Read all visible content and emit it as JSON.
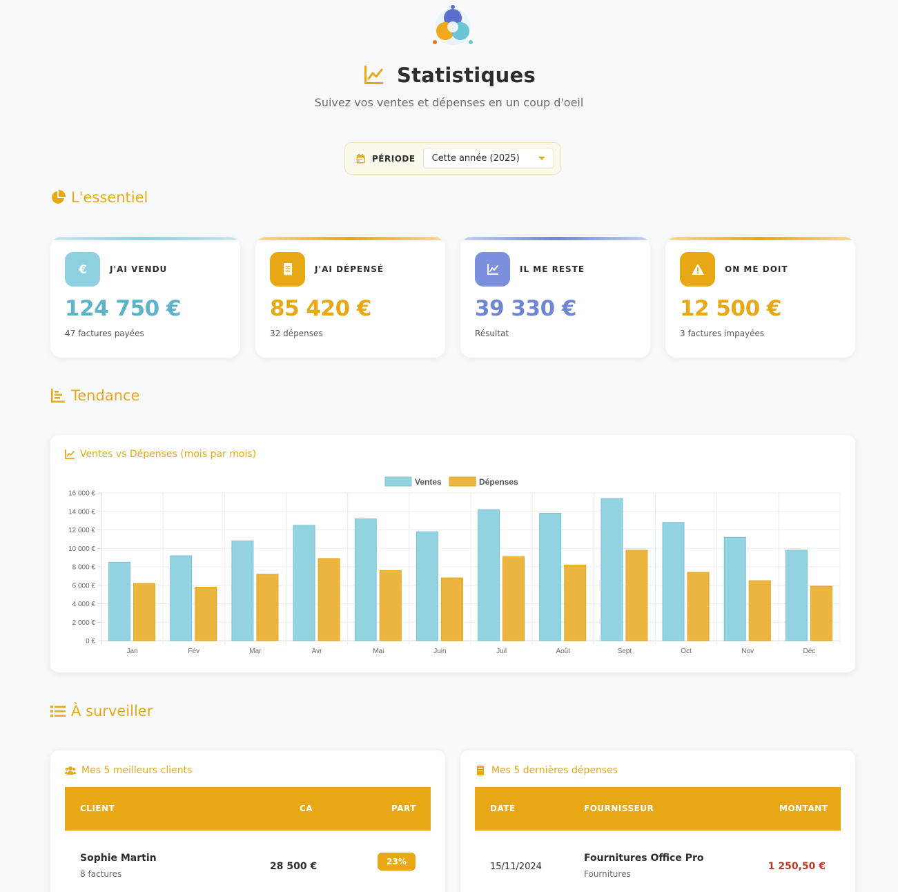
{
  "header": {
    "title": "Statistiques",
    "subtitle": "Suivez vos ventes et dépenses en un coup d'oeil"
  },
  "period": {
    "label": "PÉRIODE",
    "selected": "Cette année (2025)"
  },
  "sections": {
    "essentiel": "L'essentiel",
    "tendance": "Tendance",
    "surveiller": "À surveiller"
  },
  "kpis": [
    {
      "label": "J'AI VENDU",
      "value": "124 750 €",
      "sub": "47 factures payées",
      "color": "#5fb3c9",
      "icon": "euro-icon"
    },
    {
      "label": "J'AI DÉPENSÉ",
      "value": "85 420 €",
      "sub": "32 dépenses",
      "color": "#e8a816",
      "icon": "receipt-icon"
    },
    {
      "label": "IL ME RESTE",
      "value": "39 330 €",
      "sub": "Résultat",
      "color": "#6f86d6",
      "icon": "chart-line-icon"
    },
    {
      "label": "ON ME DOIT",
      "value": "12 500 €",
      "sub": "3 factures impayées",
      "color": "#e8a816",
      "icon": "warning-icon"
    }
  ],
  "chart_card": {
    "title": "Ventes vs Dépenses (mois par mois)"
  },
  "chart_data": {
    "type": "bar",
    "categories": [
      "Jan",
      "Fév",
      "Mar",
      "Avr",
      "Mai",
      "Juin",
      "Juil",
      "Août",
      "Sept",
      "Oct",
      "Nov",
      "Déc"
    ],
    "series": [
      {
        "name": "Ventes",
        "color": "#93d2e0",
        "values": [
          8500,
          9200,
          10800,
          12500,
          13200,
          11800,
          14200,
          13800,
          15400,
          12800,
          11200,
          9800
        ]
      },
      {
        "name": "Dépenses",
        "color": "#ecb53f",
        "values": [
          6200,
          5800,
          7200,
          8900,
          7600,
          6800,
          9100,
          8200,
          9800,
          7400,
          6500,
          5900
        ]
      }
    ],
    "yticks": [
      "0 €",
      "2 000 €",
      "4 000 €",
      "6 000 €",
      "8 000 €",
      "10 000 €",
      "12 000 €",
      "14 000 €",
      "16 000 €"
    ],
    "ylim": [
      0,
      16000
    ],
    "legend": "top",
    "grid": true
  },
  "clients": {
    "title": "Mes 5 meilleurs clients",
    "headers": {
      "client": "CLIENT",
      "ca": "CA",
      "part": "PART"
    },
    "rows": [
      {
        "name": "Sophie Martin",
        "sub": "8 factures",
        "ca": "28 500 €",
        "part": "23%"
      }
    ]
  },
  "expenses": {
    "title": "Mes 5 dernières dépenses",
    "headers": {
      "date": "DATE",
      "supplier": "FOURNISSEUR",
      "amount": "MONTANT"
    },
    "rows": [
      {
        "date": "15/11/2024",
        "supplier": "Fournitures Office Pro",
        "category": "Fournitures",
        "amount": "1 250,50 €",
        "amount_color": "#c0392b"
      }
    ]
  }
}
